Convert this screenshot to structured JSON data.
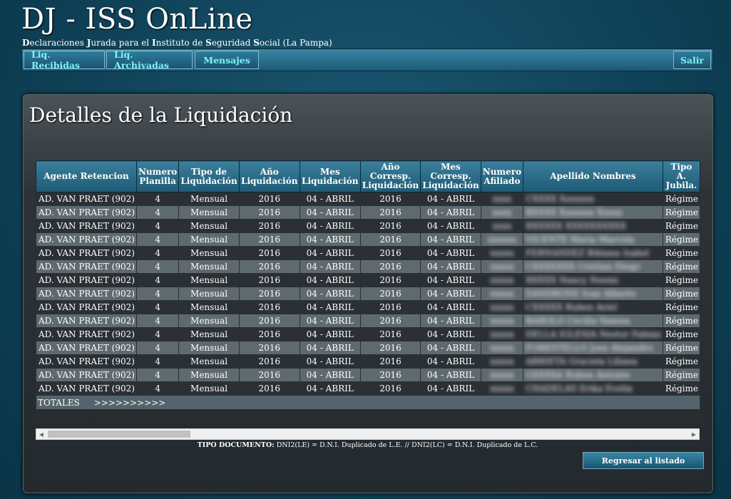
{
  "header": {
    "title": "DJ - ISS OnLine",
    "subtitle_parts": [
      {
        "text": "D",
        "bold": true
      },
      {
        "text": "eclaraciones ",
        "bold": false
      },
      {
        "text": "J",
        "bold": true
      },
      {
        "text": "urada para el ",
        "bold": false
      },
      {
        "text": "I",
        "bold": true
      },
      {
        "text": "nstituto de ",
        "bold": false
      },
      {
        "text": "S",
        "bold": true
      },
      {
        "text": "eguridad ",
        "bold": false
      },
      {
        "text": "S",
        "bold": true
      },
      {
        "text": "ocial (La Pampa)",
        "bold": false
      }
    ]
  },
  "nav": {
    "received": "Liq. Recibidas",
    "archived": "Liq. Archivadas",
    "messages": "Mensajes",
    "logout": "Salir"
  },
  "panel": {
    "title": "Detalles de la Liquidación"
  },
  "table": {
    "columns": [
      "Agente Retencion",
      "Numero Planilla",
      "Tipo de Liquidación",
      "Año Liquidación",
      "Mes Liquidación",
      "Año Corresp. Liquidación",
      "Mes Corresp. Liquidación",
      "Numero Afiliado",
      "Apellido Nombres",
      "Tipo A. Jubila."
    ],
    "rows": [
      [
        "AD. VAN PRAET (902)",
        "4",
        "Mensual",
        "2016",
        "04 - ABRIL",
        "2016",
        "04 - ABRIL",
        "xxxx",
        "CXXXX Xxxxxxx",
        "Régime"
      ],
      [
        "AD. VAN PRAET (902)",
        "4",
        "Mensual",
        "2016",
        "04 - ABRIL",
        "2016",
        "04 - ABRIL",
        "xxxx",
        "BXXXX Xxxxxxx Xxxxx",
        "Régime"
      ],
      [
        "AD. VAN PRAET (902)",
        "4",
        "Mensual",
        "2016",
        "04 - ABRIL",
        "2016",
        "04 - ABRIL",
        "xxxx",
        "RXXXXX XXXXXXXXXX",
        "Régime"
      ],
      [
        "AD. VAN PRAET (902)",
        "4",
        "Mensual",
        "2016",
        "04 - ABRIL",
        "2016",
        "04 - ABRIL",
        "xxxxxx",
        "VICENTE Maria Marcela",
        "Régime"
      ],
      [
        "AD. VAN PRAET (902)",
        "4",
        "Mensual",
        "2016",
        "04 - ABRIL",
        "2016",
        "04 - ABRIL",
        "xxxxx",
        "FERNANDEZ Bibiana Isabel",
        "Régime"
      ],
      [
        "AD. VAN PRAET (902)",
        "4",
        "Mensual",
        "2016",
        "04 - ABRIL",
        "2016",
        "04 - ABRIL",
        "xxxxx",
        "CXXXXXXX Cristian Diego",
        "Régime"
      ],
      [
        "AD. VAN PRAET (902)",
        "4",
        "Mensual",
        "2016",
        "04 - ABRIL",
        "2016",
        "04 - ABRIL",
        "xxxxx",
        "RXXXX Nancy Noemi",
        "Régime"
      ],
      [
        "AD. VAN PRAET (902)",
        "4",
        "Mensual",
        "2016",
        "04 - ABRIL",
        "2016",
        "04 - ABRIL",
        "xxxxx",
        "SANDRONE Ivan Alberto",
        "Régime"
      ],
      [
        "AD. VAN PRAET (902)",
        "4",
        "Mensual",
        "2016",
        "04 - ABRIL",
        "2016",
        "04 - ABRIL",
        "xxxxx",
        "CXXXXX Ruben Ariel",
        "Régime"
      ],
      [
        "AD. VAN PRAET (902)",
        "4",
        "Mensual",
        "2016",
        "04 - ABRIL",
        "2016",
        "04 - ABRIL",
        "xxxxx",
        "BAROLO Cecilia Vanesa",
        "Régime"
      ],
      [
        "AD. VAN PRAET (902)",
        "4",
        "Mensual",
        "2016",
        "04 - ABRIL",
        "2016",
        "04 - ABRIL",
        "xxxxx",
        "DELLA IGLESIA Nestor Fabian",
        "Régime"
      ],
      [
        "AD. VAN PRAET (902)",
        "4",
        "Mensual",
        "2016",
        "04 - ABRIL",
        "2016",
        "04 - ABRIL",
        "xxxxx",
        "FORESTELLO Jose Alejandro",
        "Régime"
      ],
      [
        "AD. VAN PRAET (902)",
        "4",
        "Mensual",
        "2016",
        "04 - ABRIL",
        "2016",
        "04 - ABRIL",
        "xxxxx",
        "ARRIETA Graciela Liliana",
        "Régime"
      ],
      [
        "AD. VAN PRAET (902)",
        "4",
        "Mensual",
        "2016",
        "04 - ABRIL",
        "2016",
        "04 - ABRIL",
        "xxxxx",
        "GXXXXA Ruben Antonio",
        "Régime"
      ],
      [
        "AD. VAN PRAET (902)",
        "4",
        "Mensual",
        "2016",
        "04 - ABRIL",
        "2016",
        "04 - ABRIL",
        "xxxxx",
        "CHADELAS Erika Evelin",
        "Régime"
      ]
    ],
    "totals_label": "TOTALES",
    "totals_arrows": ">>>>>>>>>>"
  },
  "legend": {
    "label": "TIPO DOCUMENTO:",
    "text": "DNI2(LE) = D.N.I. Duplicado de L.E.  //  DNI2(LC) = D.N.I. Duplicado de L.C."
  },
  "back_button": "Regresar al listado",
  "colors": {
    "background": "#0f4258",
    "nav_text": "#7ff3f7",
    "header_cell": "#2c6e8a",
    "row_dark": "#2b3035",
    "row_light": "#5f6a70"
  }
}
